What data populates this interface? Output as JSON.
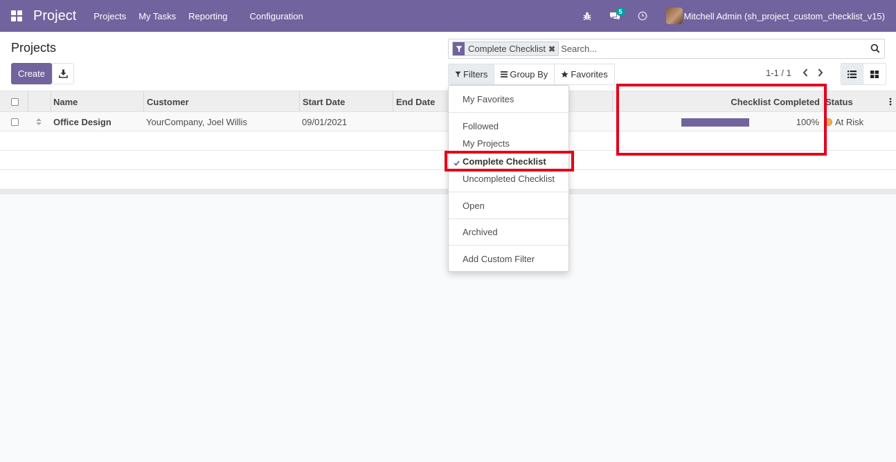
{
  "navbar": {
    "brand": "Project",
    "menu": [
      "Projects",
      "My Tasks",
      "Reporting",
      "Configuration"
    ],
    "messages_count": "5",
    "user": "Mitchell Admin (sh_project_custom_checklist_v15)"
  },
  "control_panel": {
    "title": "Projects",
    "create_label": "Create",
    "search": {
      "facet_label": "Complete Checklist",
      "placeholder": "Search..."
    },
    "filters_label": "Filters",
    "groupby_label": "Group By",
    "favorites_label": "Favorites",
    "pager": "1-1 / 1"
  },
  "table": {
    "columns": [
      "Name",
      "Customer",
      "Start Date",
      "End Date",
      "Checklist Completed",
      "Status"
    ],
    "rows": [
      {
        "name": "Office Design",
        "customer": "YourCompany, Joel Willis",
        "start_date": "09/01/2021",
        "end_date": "",
        "checklist_completed": "100%",
        "checklist_fraction": 1.0,
        "status": "At Risk"
      }
    ]
  },
  "filters_dropdown": {
    "items": [
      "My Favorites",
      "Followed",
      "My Projects",
      "Complete Checklist",
      "Uncompleted Checklist",
      "Open",
      "Archived",
      "Add Custom Filter"
    ],
    "checked": "Complete Checklist"
  },
  "colors": {
    "brand": "#71639e",
    "highlight": "#e3001b",
    "status_at_risk": "#f0ad4e"
  }
}
